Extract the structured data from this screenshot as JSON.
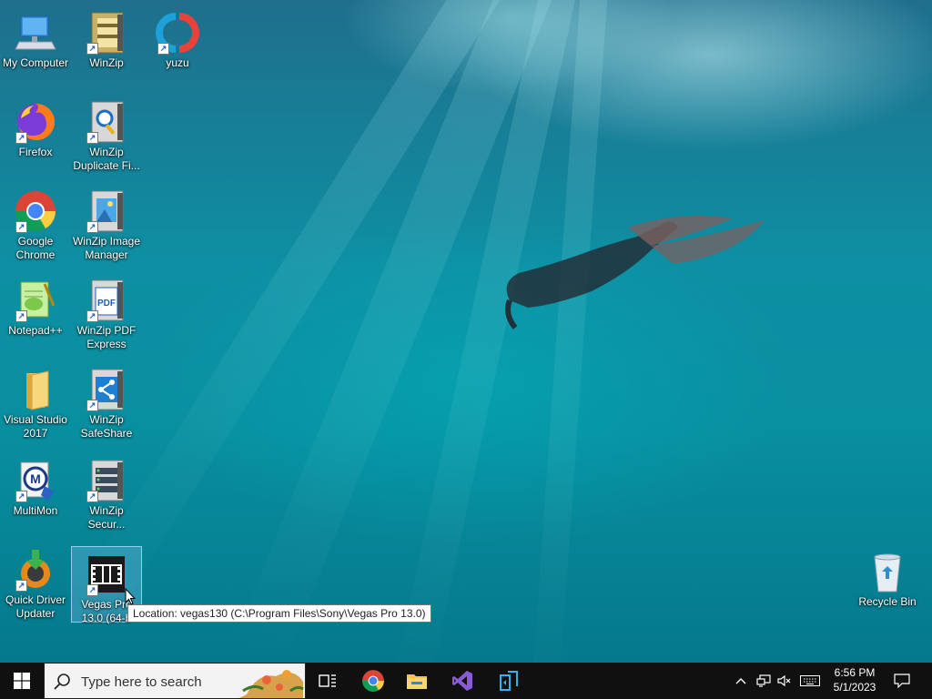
{
  "desktop": {
    "icons": [
      {
        "label": "My Computer",
        "icon": "computer-icon"
      },
      {
        "label": "WinZip",
        "icon": "winzip-icon"
      },
      {
        "label": "yuzu",
        "icon": "yuzu-icon"
      },
      {
        "label": "Firefox",
        "icon": "firefox-icon"
      },
      {
        "label": "WinZip Duplicate Fi...",
        "icon": "winzip-duplicate-icon"
      },
      {
        "label": "Google Chrome",
        "icon": "chrome-icon"
      },
      {
        "label": "WinZip Image Manager",
        "icon": "winzip-image-icon"
      },
      {
        "label": "Notepad++",
        "icon": "notepadpp-icon"
      },
      {
        "label": "WinZip PDF Express",
        "icon": "winzip-pdf-icon"
      },
      {
        "label": "Visual Studio 2017",
        "icon": "folder-icon"
      },
      {
        "label": "WinZip SafeShare",
        "icon": "winzip-safeshare-icon"
      },
      {
        "label": "MultiMon",
        "icon": "multimon-icon"
      },
      {
        "label": "WinZip Secur...",
        "icon": "winzip-secure-icon"
      },
      {
        "label": "Quick Driver Updater",
        "icon": "driver-updater-icon"
      },
      {
        "label": "Vegas Pro 13.0 (64-b",
        "icon": "vegas-icon"
      },
      {
        "label": "Recycle Bin",
        "icon": "recycle-bin-icon"
      }
    ],
    "tooltip": "Location: vegas130 (C:\\Program Files\\Sony\\Vegas Pro 13.0)"
  },
  "taskbar": {
    "search_placeholder": "Type here to search",
    "pinned": [
      "task-view-icon",
      "chrome-icon",
      "file-explorer-icon",
      "visual-studio-icon",
      "vs-installer-icon"
    ],
    "tray": [
      "chevron-up-icon",
      "network-icon",
      "volume-muted-icon",
      "keyboard-icon"
    ],
    "time": "6:56 PM",
    "date": "5/1/2023",
    "notifications_icon": "action-center-icon"
  },
  "colors": {
    "taskbar": "#101010",
    "search_box": "#f3f3f3",
    "selection": "#78bee6"
  }
}
